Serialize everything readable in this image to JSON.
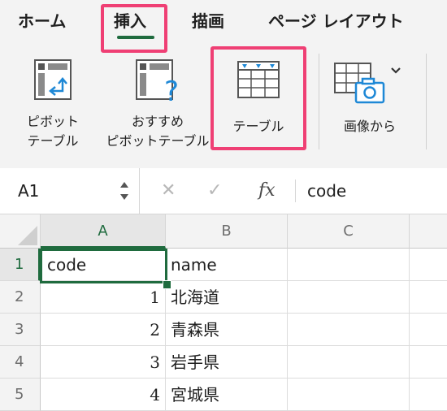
{
  "ribbon": {
    "tabs": {
      "home": "ホーム",
      "insert": "挿入",
      "draw": "描画",
      "page_layout": "ページ レイアウト"
    },
    "buttons": {
      "pivot_line1": "ピボット",
      "pivot_line2": "テーブル",
      "recommended_line1": "おすすめ",
      "recommended_line2": "ピボットテーブル",
      "table": "テーブル",
      "picture": "画像から"
    },
    "colors": {
      "accent": "#1f6b3e",
      "highlight": "#ef3f74",
      "icon_blue": "#1e88d6"
    }
  },
  "formula_bar": {
    "name_box": "A1",
    "formula": "code",
    "icons": [
      "cancel-icon",
      "enter-icon",
      "fx-icon"
    ]
  },
  "grid": {
    "columns": [
      "A",
      "B",
      "C"
    ],
    "rows": [
      {
        "num": "1",
        "a": "code",
        "b": "name"
      },
      {
        "num": "2",
        "a": "1",
        "b": "北海道"
      },
      {
        "num": "3",
        "a": "2",
        "b": "青森県"
      },
      {
        "num": "4",
        "a": "3",
        "b": "岩手県"
      },
      {
        "num": "5",
        "a": "4",
        "b": "宮城県"
      }
    ],
    "active_cell": "A1"
  }
}
